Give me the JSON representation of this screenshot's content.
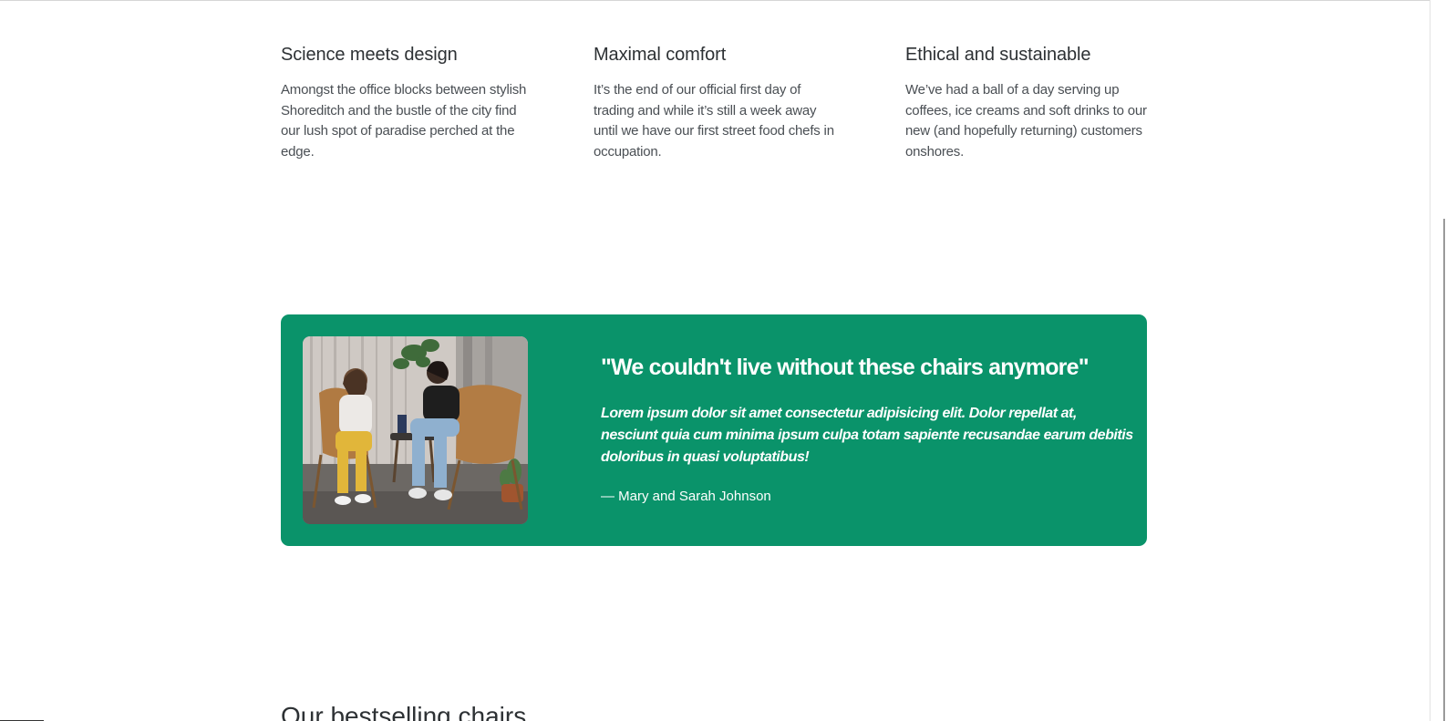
{
  "features": [
    {
      "title": "Science meets design",
      "text": "Amongst the office blocks between stylish Shoreditch and the bustle of the city find our lush spot of paradise perched at the edge."
    },
    {
      "title": "Maximal comfort",
      "text": "It’s the end of our official first day of trading and while it’s still a week away until we have our first street food chefs in occupation."
    },
    {
      "title": "Ethical and sustainable",
      "text": "We’ve had a ball of a day serving up coffees, ice creams and soft drinks to our new (and hopefully returning) customers onshores."
    }
  ],
  "testimonial": {
    "quote": "\"We couldn't live without these chairs anymore\"",
    "body": "Lorem ipsum dolor sit amet consectetur adipisicing elit. Dolor repellat at, nesciunt quia cum minima ipsum culpa totam sapiente recusandae earum debitis doloribus in quasi voluptatibus!",
    "author": "— Mary and Sarah Johnson",
    "background_color": "#0a936a",
    "image_icon": "photo-two-women-on-chairs"
  },
  "next_section": {
    "heading": "Our bestselling chairs"
  }
}
